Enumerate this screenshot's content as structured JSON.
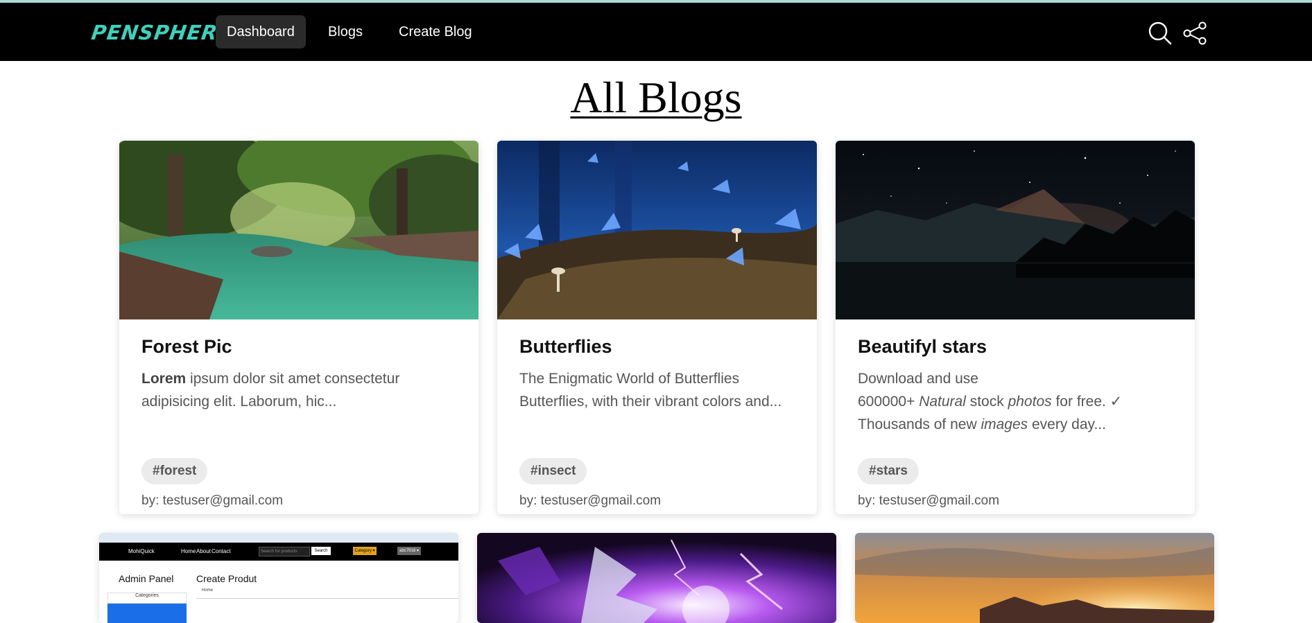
{
  "app": {
    "logo": "PENSPHERE",
    "accent": "#3fd0bc"
  },
  "nav": {
    "items": [
      {
        "label": "Dashboard",
        "active": true
      },
      {
        "label": "Blogs",
        "active": false
      },
      {
        "label": "Create Blog",
        "active": false
      }
    ],
    "icons": [
      "search-icon",
      "share-icon"
    ]
  },
  "page": {
    "title": "All Blogs"
  },
  "cards": [
    {
      "title": "Forest Pic",
      "desc_bold": "Lorem",
      "desc_rest": " ipsum dolor sit amet consectetur adipisicing elit. Laborum, hic...",
      "tag": "#forest",
      "author": "by: testuser@gmail.com",
      "image": "forest-river"
    },
    {
      "title": "Butterflies",
      "desc": "The Enigmatic World of Butterflies Butterflies, with their vibrant colors and...",
      "tag": "#insect",
      "author": "by: testuser@gmail.com",
      "image": "blue-butterflies"
    },
    {
      "title": "Beautifyl stars",
      "desc_parts": [
        "Download and use",
        "600000+ ",
        "Natural",
        " stock ",
        "photos",
        " for free. ✓",
        "Thousands of new ",
        "images",
        " every day..."
      ],
      "tag": "#stars",
      "author": "by: testuser@gmail.com",
      "image": "starry-mountain-lake"
    }
  ],
  "second_row": {
    "card1": {
      "screenshot_brand": "MohiQuick",
      "screenshot_nav": [
        "Home",
        "About",
        "Contact"
      ],
      "screenshot_search_placeholder": "Search for products",
      "screenshot_search_button": "Search",
      "screenshot_category": "Category ▾",
      "screenshot_user": "abc7918 ▾",
      "screenshot_sidebar_title": "Admin Panel",
      "screenshot_sidebar_item": "Categories",
      "screenshot_heading": "Create Produt",
      "screenshot_select": "Home"
    },
    "card2": {
      "image": "anime-lightning"
    },
    "card3": {
      "image": "sunset-mountains"
    }
  }
}
